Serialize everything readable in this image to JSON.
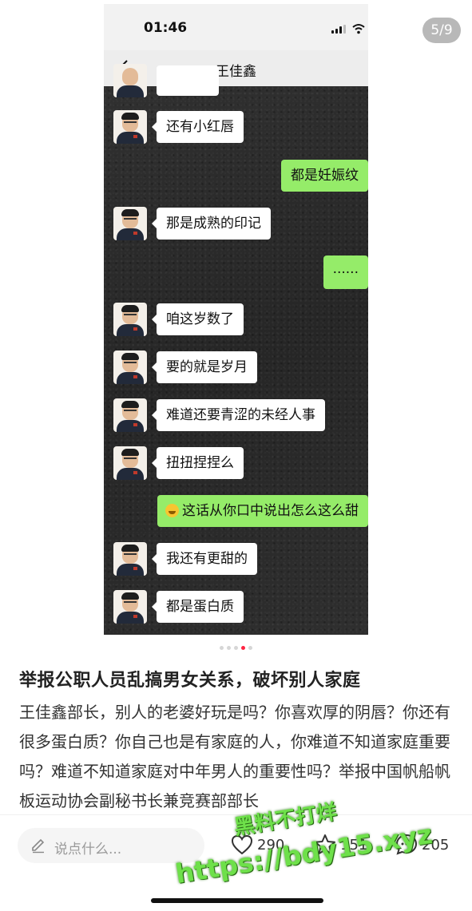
{
  "viewer": {
    "counter": "5/9"
  },
  "screenshot": {
    "status_time": "01:46",
    "chat_title": "王佳鑫",
    "messages": [
      {
        "side": "in",
        "text": "还有小红唇"
      },
      {
        "side": "out",
        "text": "都是妊娠纹"
      },
      {
        "side": "in",
        "text": "那是成熟的印记"
      },
      {
        "side": "out",
        "text": "......"
      },
      {
        "side": "in",
        "text": "咱这岁数了"
      },
      {
        "side": "in",
        "text": "要的就是岁月"
      },
      {
        "side": "in",
        "text": "难道还要青涩的未经人事"
      },
      {
        "side": "in",
        "text": "扭扭捏捏么"
      },
      {
        "side": "out",
        "text": "这话从你口中说出怎么这么甜",
        "emoji": "grinning-face-emoji"
      },
      {
        "side": "in",
        "text": "我还有更甜的"
      },
      {
        "side": "in",
        "text": "都是蛋白质"
      }
    ]
  },
  "carousel": {
    "total_dots": 5,
    "active_dot": 4
  },
  "post": {
    "title": "举报公职人员乱搞男女关系，破坏别人家庭",
    "body": "王佳鑫部长，别人的老婆好玩是吗？你喜欢厚的阴唇？你还有很多蛋白质？你自己也是有家庭的人，你难道不知道家庭重要吗？难道不知道家庭对中年男人的重要性吗？举报中国帆船帆板运动协会副秘书长兼竞赛部部长"
  },
  "bottom_bar": {
    "comment_placeholder": "说点什么...",
    "likes": "290",
    "favorites": "151",
    "comments": "205",
    "accent_color": "#ff2442"
  },
  "watermark": {
    "line1": "黑料不打烊",
    "line2": "https://bdy15.xyz"
  }
}
